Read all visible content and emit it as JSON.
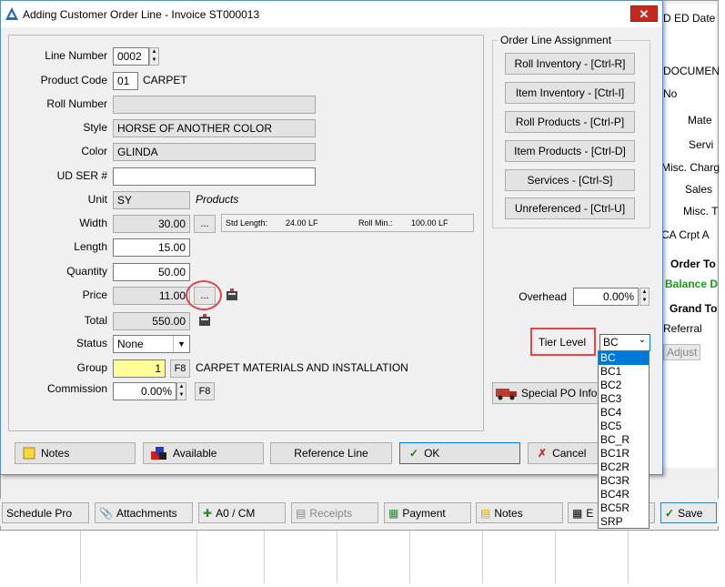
{
  "background": {
    "right_labels": [
      "D ED Date",
      "DOCUMEN",
      "No",
      "Mate",
      "Servi",
      "Misc. Charg",
      "Sales",
      "Misc. T",
      "CA Crpt A",
      "Order To",
      "Balance D",
      "Grand To",
      "Referral",
      "Adjust"
    ],
    "toolbar": [
      "Schedule Pro",
      "Attachments",
      "A0 / CM",
      "Receipts",
      "Payment",
      "Notes",
      "E",
      "Save"
    ]
  },
  "dialog": {
    "title": "Adding Customer Order Line - Invoice ST000013",
    "close_label": "✕",
    "fields": {
      "line_number": {
        "label": "Line Number",
        "value": "0002"
      },
      "product_code": {
        "label": "Product Code",
        "value": "01",
        "desc": "CARPET"
      },
      "roll_number": {
        "label": "Roll Number",
        "value": ""
      },
      "style": {
        "label": "Style",
        "value": "HORSE OF ANOTHER COLOR"
      },
      "color": {
        "label": "Color",
        "value": "GLINDA"
      },
      "ud_ser": {
        "label": "UD SER #",
        "value": ""
      },
      "unit": {
        "label": "Unit",
        "value": "SY",
        "desc": "Products"
      },
      "width": {
        "label": "Width",
        "value": "30.00",
        "std_length_label": "Std Length:",
        "std_length_value": "24.00 LF",
        "roll_min_label": "Roll Min.:",
        "roll_min_value": "100.00 LF"
      },
      "length": {
        "label": "Length",
        "value": "15.00"
      },
      "quantity": {
        "label": "Quantity",
        "value": "50.00"
      },
      "price": {
        "label": "Price",
        "value": "11.00"
      },
      "total": {
        "label": "Total",
        "value": "550.00"
      },
      "status": {
        "label": "Status",
        "value": "None"
      },
      "group": {
        "label": "Group",
        "value": "1",
        "f8": "F8",
        "desc": "CARPET MATERIALS AND INSTALLATION"
      },
      "commission": {
        "label": "Commission",
        "value": "0.00%",
        "f8": "F8"
      }
    },
    "ellipsis": "...",
    "assignment": {
      "title": "Order Line Assignment",
      "buttons": [
        "Roll Inventory - [Ctrl-R]",
        "Item Inventory - [Ctrl-I]",
        "Roll Products - [Ctrl-P]",
        "Item Products - [Ctrl-D]",
        "Services - [Ctrl-S]",
        "Unreferenced - [Ctrl-U]"
      ]
    },
    "overhead": {
      "label": "Overhead",
      "value": "0.00%"
    },
    "tier_level": {
      "label": "Tier Level",
      "value": "BC",
      "options": [
        "BC",
        "BC1",
        "BC2",
        "BC3",
        "BC4",
        "BC5",
        "BC_R",
        "BC1R",
        "BC2R",
        "BC3R",
        "BC4R",
        "BC5R",
        "SRP"
      ]
    },
    "special_po": "Special PO Info",
    "bottom_buttons": {
      "notes": "Notes",
      "available": "Available",
      "reference": "Reference Line",
      "ok": "OK",
      "cancel": "Cancel"
    }
  }
}
